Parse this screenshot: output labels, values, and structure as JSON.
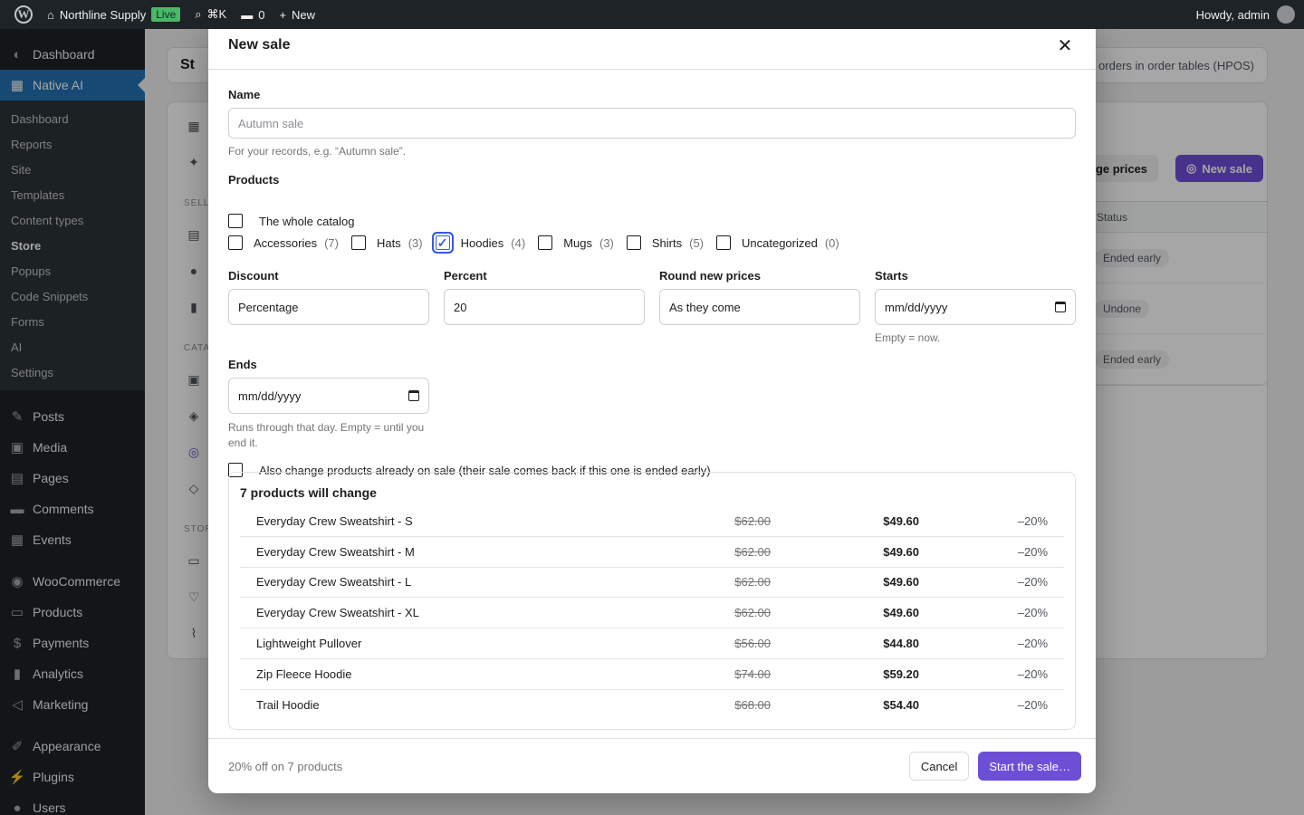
{
  "adminbar": {
    "site_name": "Northline Supply",
    "live_badge": "Live",
    "search_shortcut": "⌘K",
    "comments_count": "0",
    "new_label": "New",
    "greeting": "Howdy, admin"
  },
  "sidebar": {
    "top": [
      {
        "label": "Dashboard",
        "icon": "dashboard-icon"
      },
      {
        "label": "Native AI",
        "icon": "native-ai-icon"
      }
    ],
    "sub": [
      "Dashboard",
      "Reports",
      "Site",
      "Templates",
      "Content types",
      "Store",
      "Popups",
      "Code Snippets",
      "Forms",
      "AI",
      "Settings"
    ],
    "group1": [
      {
        "label": "Posts",
        "icon": "pin-icon"
      },
      {
        "label": "Media",
        "icon": "media-icon"
      },
      {
        "label": "Pages",
        "icon": "pages-icon"
      },
      {
        "label": "Comments",
        "icon": "comment-icon"
      },
      {
        "label": "Events",
        "icon": "calendar-icon"
      }
    ],
    "group2": [
      {
        "label": "WooCommerce",
        "icon": "woo-icon"
      },
      {
        "label": "Products",
        "icon": "archive-icon"
      },
      {
        "label": "Payments",
        "icon": "dollar-icon"
      },
      {
        "label": "Analytics",
        "icon": "chart-bar-icon"
      },
      {
        "label": "Marketing",
        "icon": "megaphone-icon"
      }
    ],
    "group3": [
      {
        "label": "Appearance",
        "icon": "brush-icon"
      },
      {
        "label": "Plugins",
        "icon": "plug-icon"
      },
      {
        "label": "Users",
        "icon": "user-icon"
      }
    ]
  },
  "background": {
    "header_title": "St",
    "hpos_text": "orders in order tables (HPOS)",
    "rail_label_1": "SELL",
    "rail_label_2": "CATA",
    "rail_label_3": "STOR",
    "change_prices": "nge prices",
    "new_sale": "New sale",
    "status_header": "Status",
    "statuses": [
      "Ended early",
      "Undone",
      "Ended early"
    ]
  },
  "modal": {
    "title": "New sale",
    "name": {
      "label": "Name",
      "placeholder": "Autumn sale",
      "help": "For your records, e.g. “Autumn sale”."
    },
    "products": {
      "label": "Products",
      "whole_catalog": "The whole catalog",
      "categories": [
        {
          "name": "Accessories",
          "count": "(7)",
          "checked": false
        },
        {
          "name": "Hats",
          "count": "(3)",
          "checked": false
        },
        {
          "name": "Hoodies",
          "count": "(4)",
          "checked": true
        },
        {
          "name": "Mugs",
          "count": "(3)",
          "checked": false
        },
        {
          "name": "Shirts",
          "count": "(5)",
          "checked": false
        },
        {
          "name": "Uncategorized",
          "count": "(0)",
          "checked": false
        }
      ]
    },
    "discount": {
      "label": "Discount",
      "value": "Percentage"
    },
    "percent": {
      "label": "Percent",
      "value": "20"
    },
    "round": {
      "label": "Round new prices",
      "value": "As they come"
    },
    "starts": {
      "label": "Starts",
      "value": "mm/dd/yyyy",
      "help": "Empty = now."
    },
    "ends": {
      "label": "Ends",
      "value": "mm/dd/yyyy",
      "help": "Runs through that day. Empty = until you end it."
    },
    "also_change": "Also change products already on sale (their sale comes back if this one is ended early)",
    "preview_title": "7 products will change",
    "preview_rows": [
      {
        "name": "Everyday Crew Sweatshirt - S",
        "old": "$62.00",
        "new": "$49.60",
        "pct": "–20%"
      },
      {
        "name": "Everyday Crew Sweatshirt - M",
        "old": "$62.00",
        "new": "$49.60",
        "pct": "–20%"
      },
      {
        "name": "Everyday Crew Sweatshirt - L",
        "old": "$62.00",
        "new": "$49.60",
        "pct": "–20%"
      },
      {
        "name": "Everyday Crew Sweatshirt - XL",
        "old": "$62.00",
        "new": "$49.60",
        "pct": "–20%"
      },
      {
        "name": "Lightweight Pullover",
        "old": "$56.00",
        "new": "$44.80",
        "pct": "–20%"
      },
      {
        "name": "Zip Fleece Hoodie",
        "old": "$74.00",
        "new": "$59.20",
        "pct": "–20%"
      },
      {
        "name": "Trail Hoodie",
        "old": "$68.00",
        "new": "$54.40",
        "pct": "–20%"
      }
    ],
    "summary": "20% off on 7 products",
    "cancel": "Cancel",
    "start": "Start the sale…"
  }
}
